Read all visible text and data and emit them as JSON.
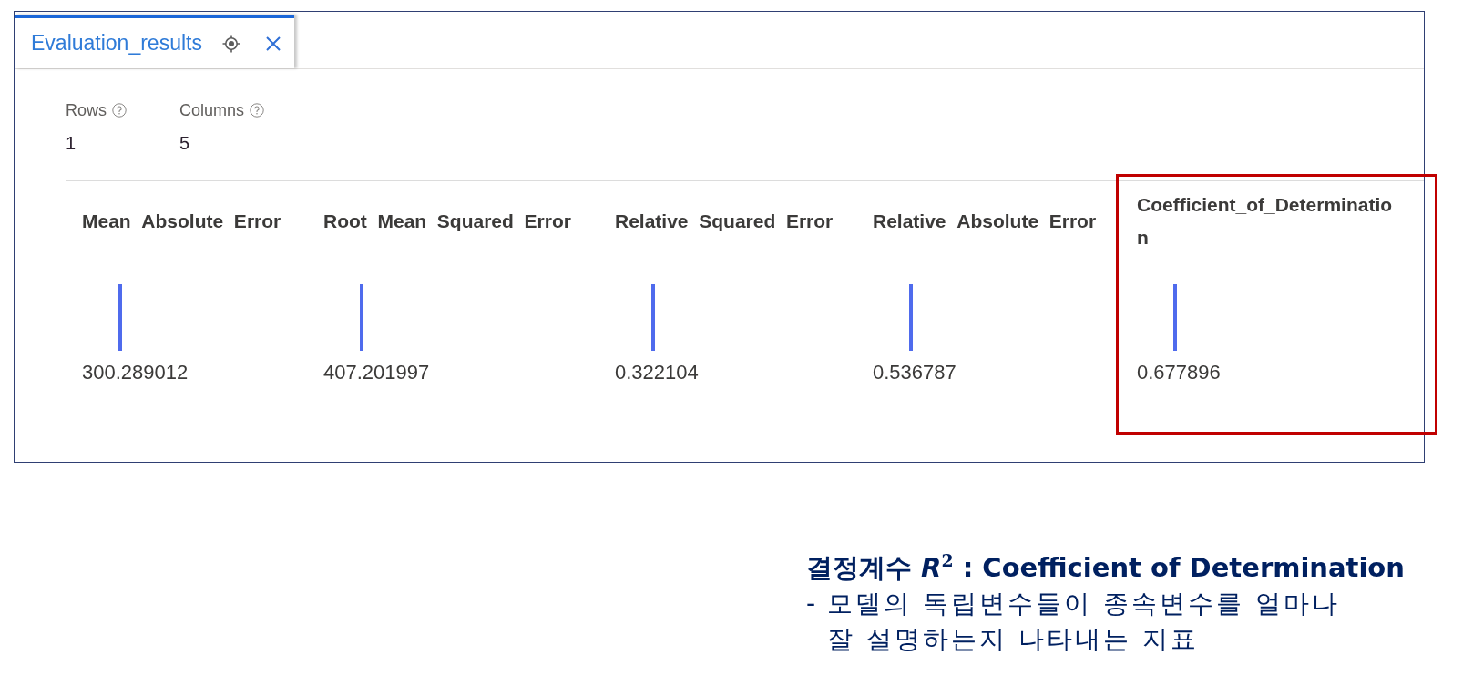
{
  "tabs": [
    {
      "label": "Evaluation_results",
      "selected": true
    }
  ],
  "stats": [
    {
      "label": "Rows",
      "value": "1"
    },
    {
      "label": "Columns",
      "value": "5"
    }
  ],
  "metrics": [
    {
      "name": "Mean_Absolute_Error",
      "value": "300.289012",
      "highlighted": false
    },
    {
      "name": "Root_Mean_Squared_Error",
      "value": "407.201997",
      "highlighted": false
    },
    {
      "name": "Relative_Squared_Error",
      "value": "0.322104",
      "highlighted": false
    },
    {
      "name": "Relative_Absolute_Error",
      "value": "0.536787",
      "highlighted": false
    },
    {
      "name": "Coefficient_of_Determination",
      "value": "0.677896",
      "highlighted": true
    }
  ],
  "note": {
    "title": "결정계수 *R*$^{2}$ : Coefficient of Determination",
    "items": [
      {
        "marker": "-",
        "lines": [
          "모델의 독립변수들이 종속변수를 얼마나",
          "잘 설명하는지 나타내는 지표"
        ]
      }
    ]
  }
}
